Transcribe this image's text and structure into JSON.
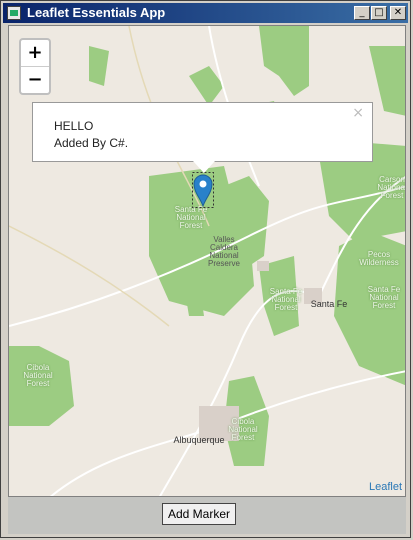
{
  "window": {
    "title": "Leaflet Essentials App",
    "minimize_glyph": "_",
    "maximize_glyph": "□",
    "close_glyph": "✕"
  },
  "map": {
    "zoom_in": "+",
    "zoom_out": "−",
    "popup": {
      "line1": "HELLO",
      "line2": "Added By C#.",
      "close": "×"
    },
    "labels": {
      "santa_fe_nf_1": "Santa Fe National Forest",
      "valles_caldera": "Valles Caldera National Preserve",
      "santa_fe_nf_2": "Santa Fe National Forest",
      "santa_fe": "Santa Fe",
      "carson_nf": "Carson National Forest",
      "pecos": "Pecos Wilderness",
      "santa_fe_nf_3": "Santa Fe National Forest",
      "cibola_nf_1": "Cibola National Forest",
      "cibola_nf_2": "Cibola National Forest",
      "albuquerque": "Albuquerque"
    },
    "attribution": "Leaflet",
    "colors": {
      "land": "#eee9e1",
      "forest": "#9ccc82",
      "marker": "#2981ca"
    }
  },
  "footer": {
    "add_marker_button": "Add Marker"
  }
}
